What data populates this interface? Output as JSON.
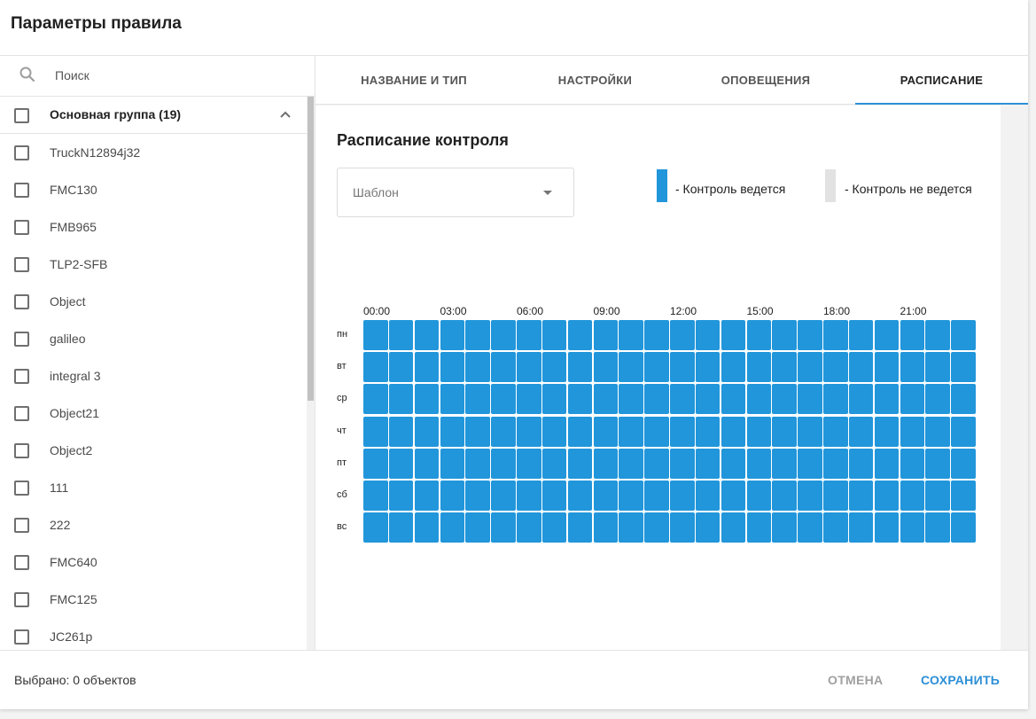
{
  "dialog": {
    "title": "Параметры правила"
  },
  "search": {
    "placeholder": "Поиск"
  },
  "group": {
    "label": "Основная группа (19)",
    "checked": false,
    "expanded": true
  },
  "objects": [
    "TruckN12894j32",
    "FMC130",
    "FMB965",
    "TLP2-SFB",
    "Object",
    "galileo",
    "integral 3",
    "Object21",
    "Object2",
    "111",
    "222",
    "FMC640",
    "FMC125",
    "JC261p"
  ],
  "tabs": [
    {
      "label": "НАЗВАНИЕ И ТИП",
      "active": false
    },
    {
      "label": "НАСТРОЙКИ",
      "active": false
    },
    {
      "label": "ОПОВЕЩЕНИЯ",
      "active": false
    },
    {
      "label": "РАСПИСАНИЕ",
      "active": true
    }
  ],
  "schedule": {
    "title": "Расписание контроля",
    "template_placeholder": "Шаблон",
    "legend": {
      "on": {
        "label": "- Контроль ведется",
        "color": "#2196db"
      },
      "off": {
        "label": "- Контроль не ведется",
        "color": "#e2e2e2"
      }
    },
    "hour_labels": [
      "00:00",
      "03:00",
      "06:00",
      "09:00",
      "12:00",
      "15:00",
      "18:00",
      "21:00"
    ],
    "days": [
      "пн",
      "вт",
      "ср",
      "чт",
      "пт",
      "сб",
      "вс"
    ],
    "slots_per_day": 24,
    "all_active": true
  },
  "footer": {
    "selected_text": "Выбрано: 0 объектов",
    "cancel_label": "ОТМЕНА",
    "save_label": "СОХРАНИТЬ"
  }
}
